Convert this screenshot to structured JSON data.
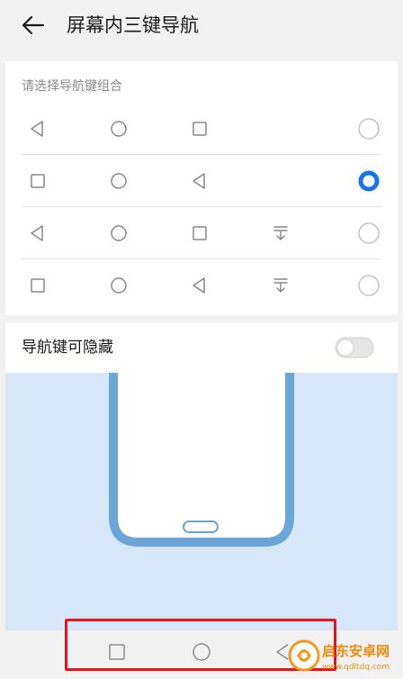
{
  "header": {
    "title": "屏幕内三键导航",
    "back_icon": "arrow-left-icon"
  },
  "section": {
    "label": "请选择导航键组合"
  },
  "options": [
    {
      "icons": [
        "back-triangle-icon",
        "home-circle-icon",
        "recents-square-icon"
      ],
      "selected": false
    },
    {
      "icons": [
        "recents-square-icon",
        "home-circle-icon",
        "back-triangle-icon"
      ],
      "selected": true
    },
    {
      "icons": [
        "back-triangle-icon",
        "home-circle-icon",
        "recents-square-icon",
        "notification-pulldown-icon"
      ],
      "selected": false
    },
    {
      "icons": [
        "recents-square-icon",
        "home-circle-icon",
        "back-triangle-icon",
        "notification-pulldown-icon"
      ],
      "selected": false
    }
  ],
  "hide_toggle": {
    "label": "导航键可隐藏",
    "on": false
  },
  "bottom_nav": {
    "icons": [
      "recents-square-icon",
      "home-circle-icon",
      "back-triangle-icon"
    ]
  },
  "watermark": {
    "name": "启东安卓网",
    "url": "www.qdltdq.com"
  },
  "colors": {
    "accent": "#1a73e8",
    "highlight": "#e8121a",
    "preview_bg": "#d8e7f8",
    "phone_frame": "#6aa6d8"
  }
}
